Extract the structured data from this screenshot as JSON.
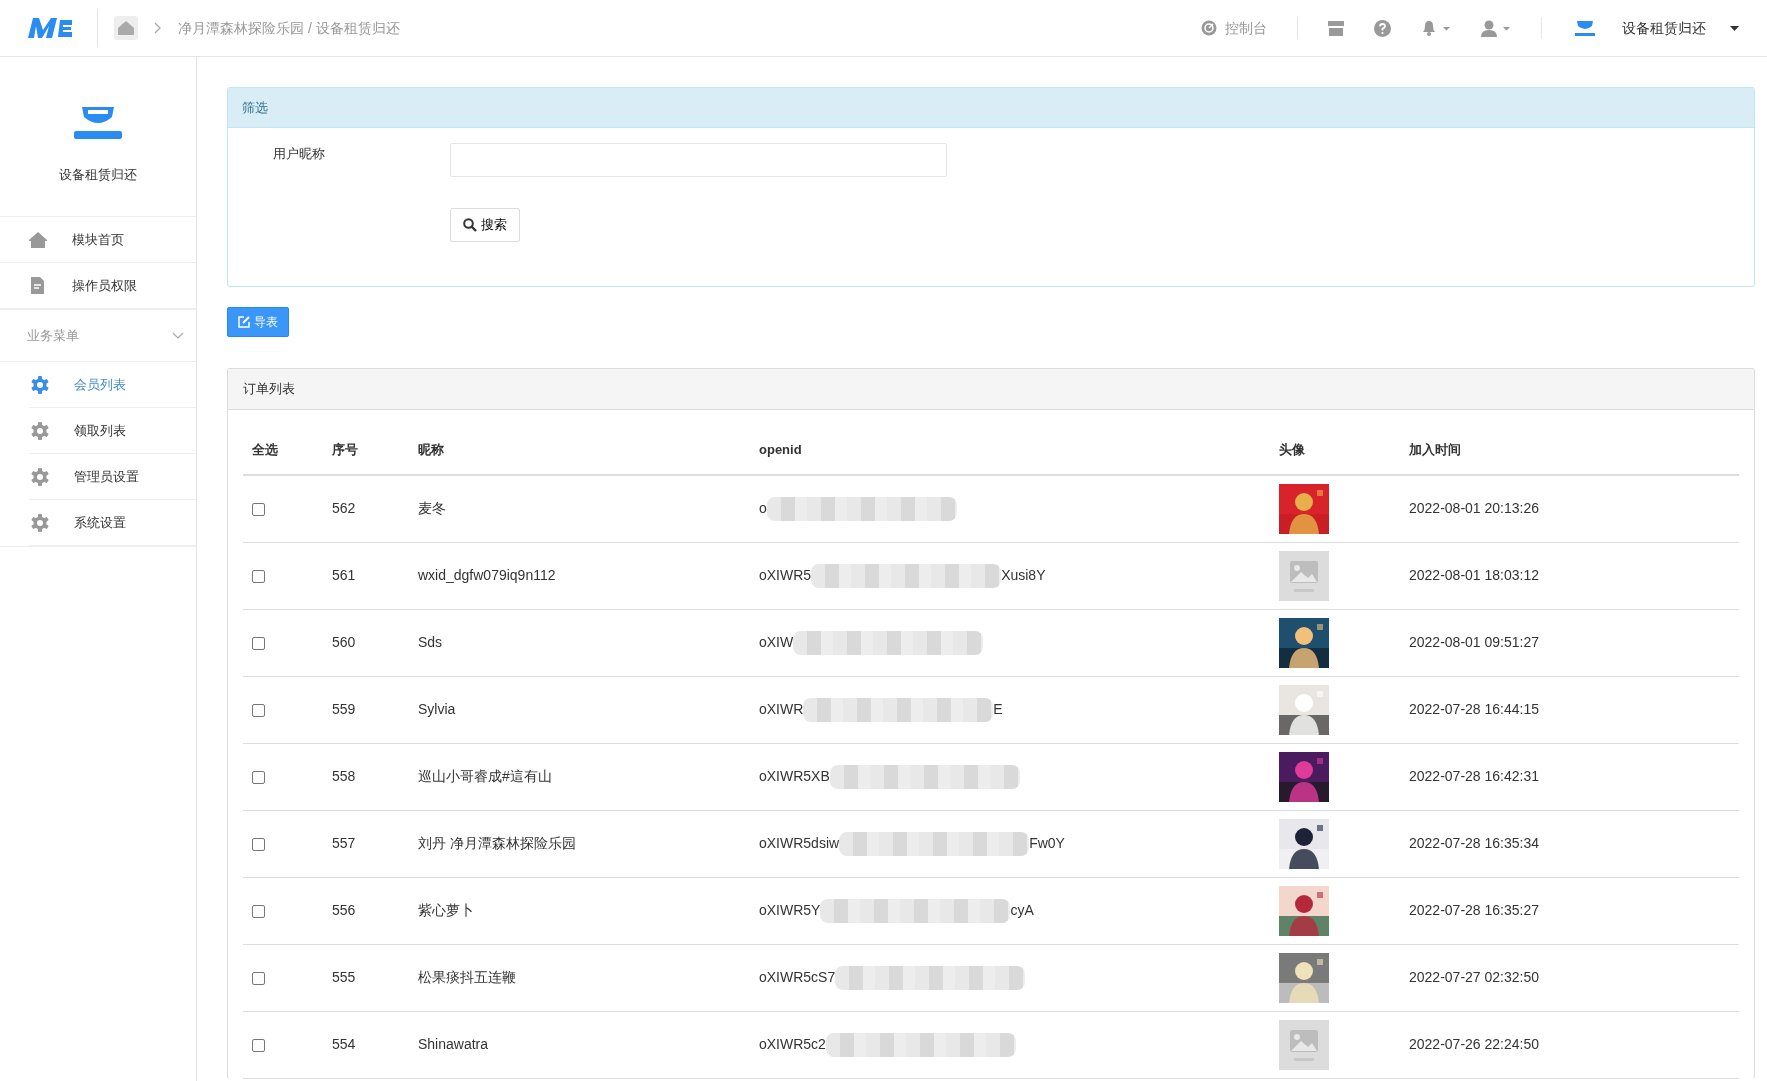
{
  "topbar": {
    "breadcrumb": [
      "净月潭森林探险乐园",
      "设备租赁归还"
    ],
    "breadcrumb_separator": "/",
    "console": "控制台",
    "account": "设备租赁归还"
  },
  "sidebar": {
    "title": "设备租赁归还",
    "items": [
      {
        "label": "模块首页",
        "kind": "home"
      },
      {
        "label": "操作员权限",
        "kind": "doc"
      }
    ],
    "section": {
      "label": "业务菜单",
      "expanded": true,
      "items": [
        {
          "label": "会员列表",
          "selected": true
        },
        {
          "label": "领取列表",
          "selected": false
        },
        {
          "label": "管理员设置",
          "selected": false
        },
        {
          "label": "系统设置",
          "selected": false
        }
      ]
    }
  },
  "filter": {
    "title": "筛选",
    "field_label": "用户昵称",
    "search_button": "搜索"
  },
  "export_button": "导表",
  "orders": {
    "title": "订单列表",
    "columns": [
      "全选",
      "序号",
      "昵称",
      "openid",
      "头像",
      "加入时间"
    ],
    "rows": [
      {
        "checked": false,
        "no": "562",
        "nickname": "麦冬",
        "openid_start": "o",
        "openid_end": "",
        "joined": "2022-08-01 20:13:26"
      },
      {
        "checked": false,
        "no": "561",
        "nickname": "wxid_dgfw079iq9n112",
        "openid_start": "oXIWR5",
        "openid_end": "Xusi8Y",
        "avatar": {
          "kind": "placeholder"
        },
        "joined": "2022-08-01 18:03:12"
      },
      {
        "checked": false,
        "no": "560",
        "nickname": "Sds",
        "openid_start": "oXIW",
        "openid_end": "",
        "joined": "2022-08-01 09:51:27"
      },
      {
        "checked": false,
        "no": "559",
        "nickname": "Sylvia",
        "openid_start": "oXIWR",
        "openid_end": "E",
        "joined": "2022-07-28 16:44:15"
      },
      {
        "checked": false,
        "no": "558",
        "nickname": "巡山小哥睿成#這有山",
        "openid_start": "oXIWR5XB",
        "openid_end": "",
        "joined": "2022-07-28 16:42:31"
      },
      {
        "checked": false,
        "no": "557",
        "nickname": "刘丹 净月潭森林探险乐园",
        "openid_start": "oXIWR5dsiw",
        "openid_end": "Fw0Y",
        "joined": "2022-07-28 16:35:34"
      },
      {
        "checked": false,
        "no": "556",
        "nickname": "紫心萝卜",
        "openid_start": "oXIWR5Y",
        "openid_end": "cyA",
        "joined": "2022-07-28 16:35:27"
      },
      {
        "checked": false,
        "no": "555",
        "nickname": "松果痰抖五连鞭",
        "openid_start": "oXIWR5cS7",
        "openid_end": "",
        "joined": "2022-07-27 02:32:50"
      },
      {
        "checked": false,
        "no": "554",
        "nickname": "Shinawatra",
        "openid_start": "oXIWR5c2",
        "openid_end": "",
        "avatar": {
          "kind": "placeholder"
        },
        "joined": "2022-07-26 22:24:50"
      }
    ]
  }
}
